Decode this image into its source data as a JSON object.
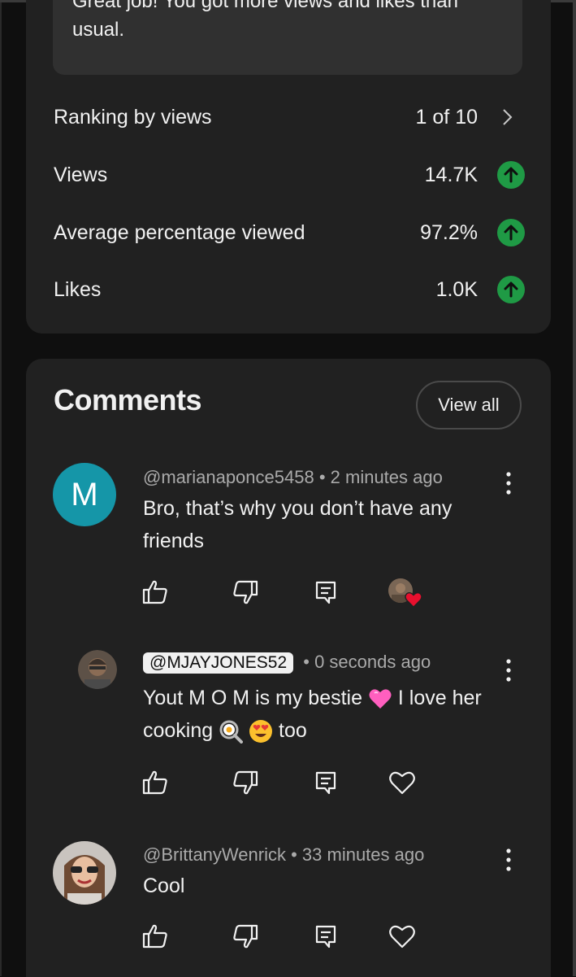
{
  "banner": {
    "text": "Great job! You got more views and likes than usual."
  },
  "metrics": [
    {
      "label": "Ranking by views",
      "value": "1 of 10",
      "indicator": "chevron-right-icon"
    },
    {
      "label": "Views",
      "value": "14.7K",
      "indicator": "arrow-up-icon"
    },
    {
      "label": "Average percentage viewed",
      "value": "97.2%",
      "indicator": "arrow-up-icon"
    },
    {
      "label": "Likes",
      "value": "1.0K",
      "indicator": "arrow-up-icon"
    }
  ],
  "colors": {
    "up_badge": "#1f9a45",
    "avatar_m": "#1596a8",
    "card": "#212121",
    "background": "#0f0f0f"
  },
  "comments_section": {
    "title": "Comments",
    "view_all_label": "View all",
    "comments": [
      {
        "avatar_letter": "M",
        "handle": "@marianaponce5458",
        "separator": " • ",
        "time": "2 minutes ago",
        "text": "Bro, that’s why you don’t have any friends",
        "creator_hearted": true
      },
      {
        "handle": "@MJAYJONES52",
        "separator": " • ",
        "time": "0 seconds ago",
        "text_part1": "Yout M O M is my bestie ",
        "text_part2": " I love her cooking ",
        "text_part3": " too",
        "emojis": [
          "pink-heart-emoji",
          "fried-egg-emoji",
          "heart-eyes-emoji"
        ]
      },
      {
        "handle": "@BrittanyWenrick",
        "separator": " • ",
        "time": "33 minutes ago",
        "text": "Cool"
      }
    ]
  }
}
